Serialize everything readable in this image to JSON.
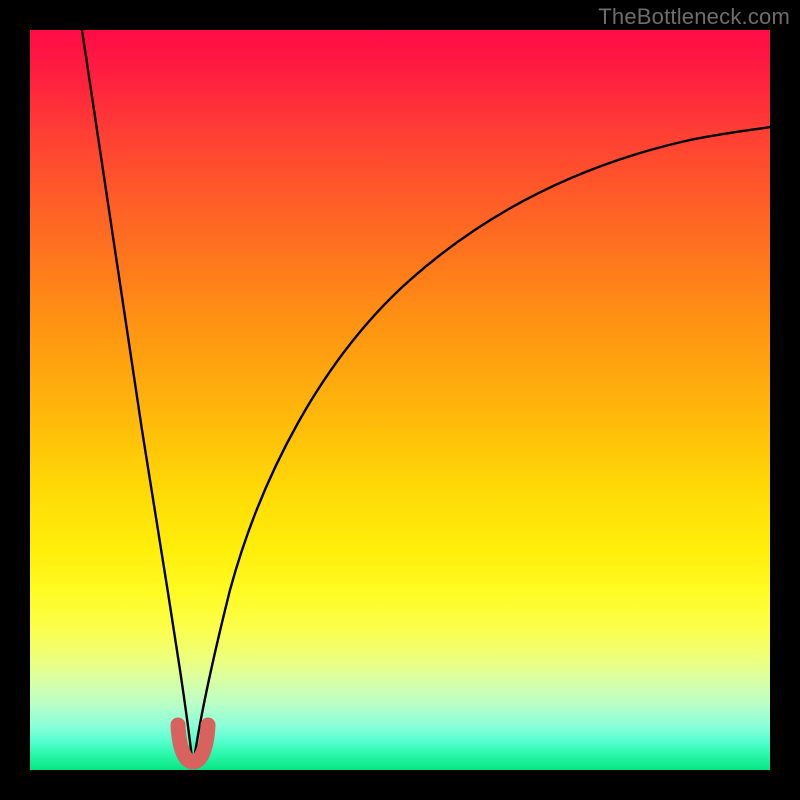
{
  "watermark": {
    "text": "TheBottleneck.com"
  },
  "colors": {
    "frame": "#000000",
    "curve": "#000000",
    "stub": "#d9625f",
    "gradient_stops": [
      "#ff0b46",
      "#ff1e3f",
      "#ff3f34",
      "#ff6a22",
      "#ff9412",
      "#ffbb0a",
      "#ffd906",
      "#ffee0a",
      "#fffb23",
      "#fbff4d",
      "#edff7d",
      "#d8ffa5",
      "#b9ffc6",
      "#8cffda",
      "#58ffcf",
      "#28f7a8",
      "#07e682"
    ]
  },
  "chart_data": {
    "type": "line",
    "title": "",
    "xlabel": "",
    "ylabel": "",
    "xlim": [
      0,
      100
    ],
    "ylim": [
      0,
      100
    ],
    "grid": false,
    "legend": false,
    "note": "Bottleneck-style chart: y is bottleneck %, minimum ≈ x=22 where the two branches meet. Values estimated from pixel positions.",
    "series": [
      {
        "name": "left-branch",
        "x": [
          7,
          9,
          11,
          13,
          15,
          17,
          19,
          20,
          21,
          22
        ],
        "y": [
          100,
          87,
          74,
          61,
          48,
          35,
          22,
          14,
          6,
          0
        ]
      },
      {
        "name": "right-branch",
        "x": [
          22,
          24,
          26,
          30,
          34,
          40,
          48,
          58,
          70,
          84,
          100
        ],
        "y": [
          0,
          8,
          17,
          32,
          44,
          56,
          66,
          74,
          80,
          84,
          87
        ]
      },
      {
        "name": "stub-marker",
        "x": [
          20,
          20.5,
          21,
          22,
          23,
          23.5,
          24
        ],
        "y": [
          6,
          3,
          1.2,
          0.4,
          1.2,
          3,
          6
        ]
      }
    ]
  }
}
